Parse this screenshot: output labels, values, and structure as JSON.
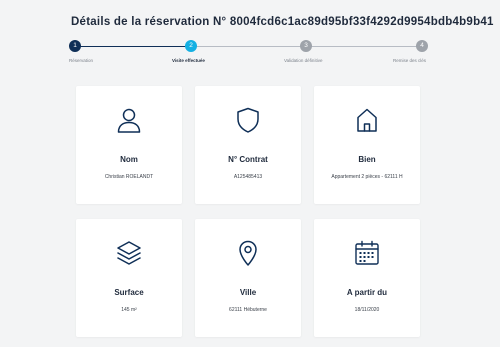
{
  "header": {
    "title": "Détails de la réservation N° 8004fcd6c1ac89d95bf33f4292d9954bdb4b9b41"
  },
  "stepper": {
    "steps": [
      {
        "number": "1",
        "label": "Réservation",
        "state": "done"
      },
      {
        "number": "2",
        "label": "Visite effectuée",
        "state": "current"
      },
      {
        "number": "3",
        "label": "Validation définitive",
        "state": "pending"
      },
      {
        "number": "4",
        "label": "Remise des clés",
        "state": "pending"
      }
    ],
    "colors": {
      "done": "#0f2f57",
      "current": "#14b0e3",
      "pending": "#9ea3aa"
    }
  },
  "cards": [
    {
      "icon": "user-icon",
      "title": "Nom",
      "value": "Christian ROELANDT"
    },
    {
      "icon": "shield-icon",
      "title": "N° Contrat",
      "value": "A125485413"
    },
    {
      "icon": "house-icon",
      "title": "Bien",
      "value": "Appartement 2 pièces - 62111 H"
    },
    {
      "icon": "layers-icon",
      "title": "Surface",
      "value": "145 m²"
    },
    {
      "icon": "map-pin-icon",
      "title": "Ville",
      "value": "62111 Hébuterne"
    },
    {
      "icon": "calendar-icon",
      "title": "A partir du",
      "value": "18/11/2020"
    }
  ],
  "icon_color": "#0f2f57"
}
